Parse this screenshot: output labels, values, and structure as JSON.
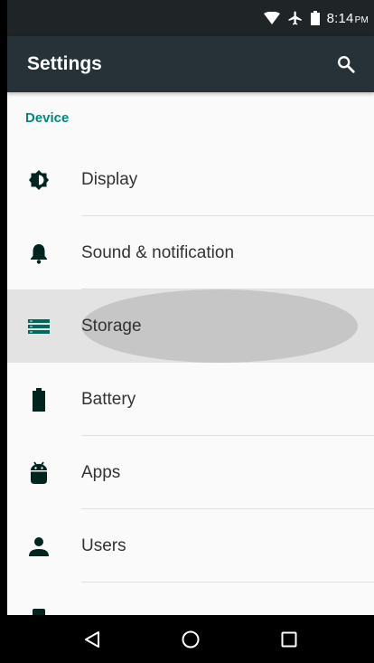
{
  "status_bar": {
    "time": "8:14",
    "ampm": "PM",
    "icons": [
      "wifi-icon",
      "airplane-icon",
      "battery-icon"
    ]
  },
  "app_bar": {
    "title": "Settings",
    "search_icon": "search-icon"
  },
  "section": {
    "title": "Device"
  },
  "items": [
    {
      "label": "Display",
      "icon": "brightness-icon"
    },
    {
      "label": "Sound & notification",
      "icon": "bell-icon"
    },
    {
      "label": "Storage",
      "icon": "storage-icon",
      "pressed": true
    },
    {
      "label": "Battery",
      "icon": "battery-icon"
    },
    {
      "label": "Apps",
      "icon": "android-icon"
    },
    {
      "label": "Users",
      "icon": "person-icon"
    }
  ],
  "nav_bar": {
    "buttons": [
      "back-icon",
      "home-icon",
      "recents-icon"
    ]
  },
  "colors": {
    "accent": "#009688",
    "app_bar": "#263238",
    "status_bar": "#1f2426",
    "pressed_bg": "#e3e3e3"
  }
}
